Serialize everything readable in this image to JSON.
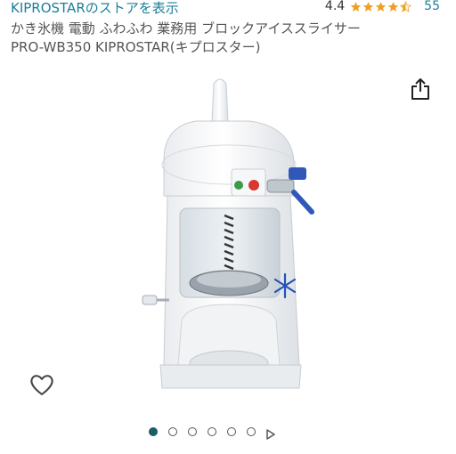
{
  "store": {
    "link_text": "KIPROSTARのストアを表示"
  },
  "rating": {
    "score": "4.4",
    "count": "55",
    "value": 4.4,
    "max": 5,
    "star_color": "#f0a020"
  },
  "product": {
    "title_line1": "かき氷機 電動 ふわふわ 業務用 ブロックアイススライサー",
    "title_line2": "PRO-WB350 KIPROSTAR(キプロスター)"
  },
  "icons": {
    "share": "share-icon",
    "favorite": "heart-icon",
    "next": "play-icon"
  },
  "gallery": {
    "total_images": 6,
    "current_index": 1,
    "active_color": "#1c5c6b"
  }
}
